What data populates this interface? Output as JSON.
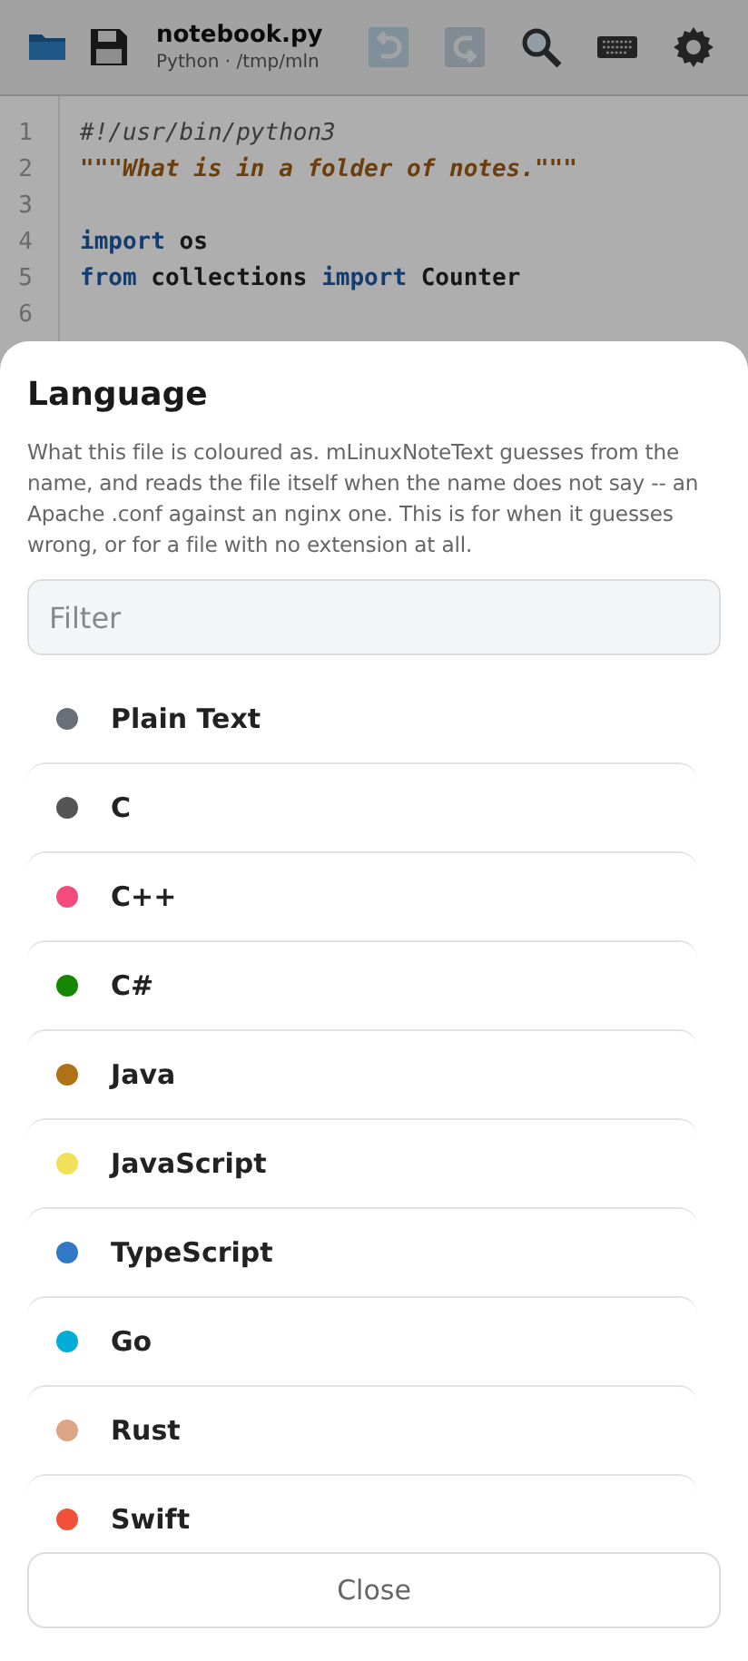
{
  "toolbar": {
    "file_name": "notebook.py",
    "file_info": "Python · /tmp/mln",
    "undo_disabled": true,
    "redo_disabled": true
  },
  "editor": {
    "lines": [
      {
        "number": "1",
        "tokens": [
          {
            "kind": "comment",
            "text": "#!/usr/bin/python3"
          }
        ]
      },
      {
        "number": "2",
        "tokens": [
          {
            "kind": "string",
            "text": "\"\"\"What is in a folder of notes.\"\"\""
          }
        ]
      },
      {
        "number": "3"
      },
      {
        "number": "4",
        "tokens": [
          {
            "kind": "keyword",
            "text": "import"
          },
          {
            "kind": "plain",
            "text": " os"
          }
        ]
      },
      {
        "number": "5",
        "tokens": [
          {
            "kind": "keyword",
            "text": "from"
          },
          {
            "kind": "plain",
            "text": " collections "
          },
          {
            "kind": "keyword",
            "text": "import"
          },
          {
            "kind": "plain",
            "text": " Counter"
          }
        ]
      },
      {
        "number": "6"
      }
    ]
  },
  "sheet": {
    "title": "Language",
    "description": "What this file is coloured as. mLinuxNoteText guesses from the name, and reads the file itself when the name does not say -- an Apache .conf against an nginx one. This is for when it guesses wrong, or for a file with no extension at all.",
    "filter": {
      "placeholder": "Filter"
    },
    "languages": [
      {
        "name": "Plain Text",
        "color": "#6a6e76"
      },
      {
        "name": "C",
        "color": "#555555"
      },
      {
        "name": "C++",
        "color": "#f34b7d"
      },
      {
        "name": "C#",
        "color": "#178600"
      },
      {
        "name": "Java",
        "color": "#b07219"
      },
      {
        "name": "JavaScript",
        "color": "#f1e05a"
      },
      {
        "name": "TypeScript",
        "color": "#3178c6"
      },
      {
        "name": "Go",
        "color": "#00add8"
      },
      {
        "name": "Rust",
        "color": "#dea584"
      },
      {
        "name": "Swift",
        "color": "#f05138"
      }
    ],
    "close_label": "Close"
  }
}
